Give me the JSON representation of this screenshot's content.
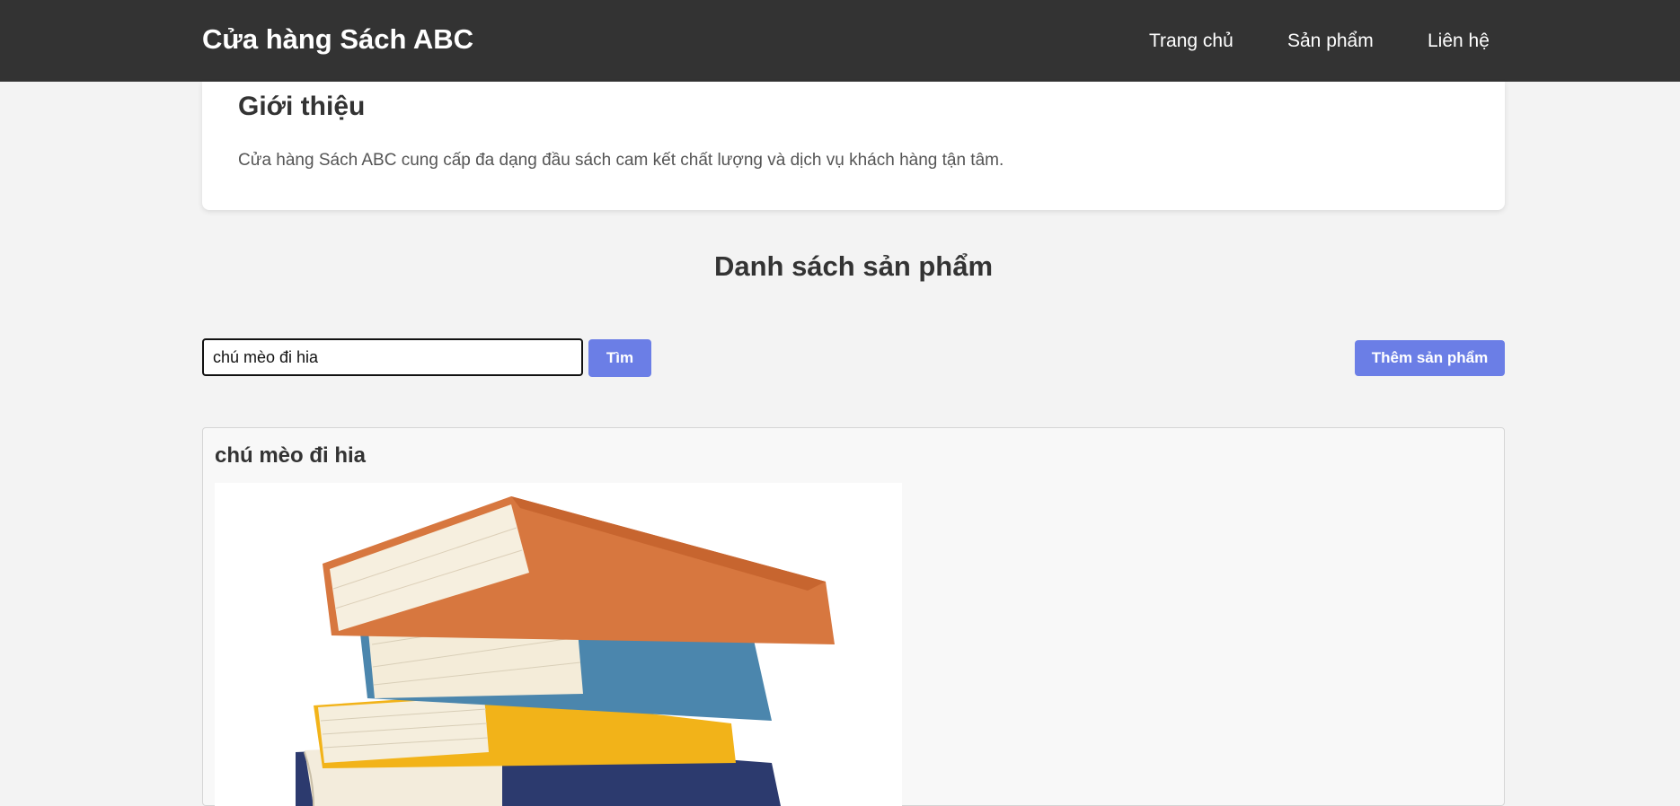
{
  "header": {
    "brand": "Cửa hàng Sách ABC",
    "nav": [
      "Trang chủ",
      "Sản phẩm",
      "Liên hệ"
    ]
  },
  "intro": {
    "title": "Giới thiệu",
    "text": "Cửa hàng Sách ABC cung cấp đa dạng đầu sách cam kết chất lượng và dịch vụ khách hàng tận tâm."
  },
  "products": {
    "heading": "Danh sách sản phẩm",
    "search_value": "chú mèo đi hia ",
    "search_button": "Tìm",
    "add_button": "Thêm sản phẩm"
  },
  "result": {
    "title": "chú mèo đi hia",
    "image_icon": "book-stack-image"
  },
  "colors": {
    "navbar": "#333333",
    "accent": "#6b7ee6",
    "page_bg": "#f3f3f3"
  }
}
